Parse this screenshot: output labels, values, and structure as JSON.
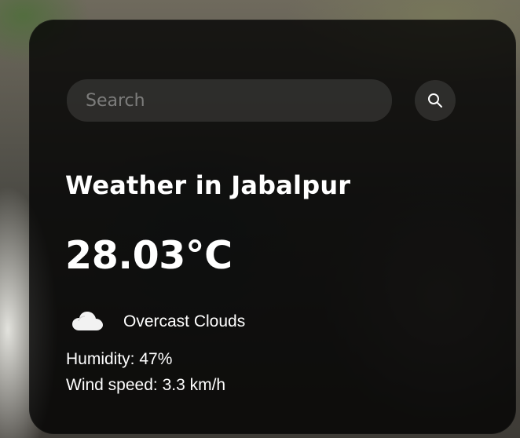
{
  "search": {
    "placeholder": "Search",
    "value": "",
    "button_icon": "search-icon"
  },
  "weather": {
    "title": "Weather in Jabalpur",
    "temperature": "28.03°C",
    "condition": "Overcast Clouds",
    "condition_icon": "cloud-icon",
    "humidity": "Humidity: 47%",
    "wind": "Wind speed: 3.3 km/h"
  }
}
